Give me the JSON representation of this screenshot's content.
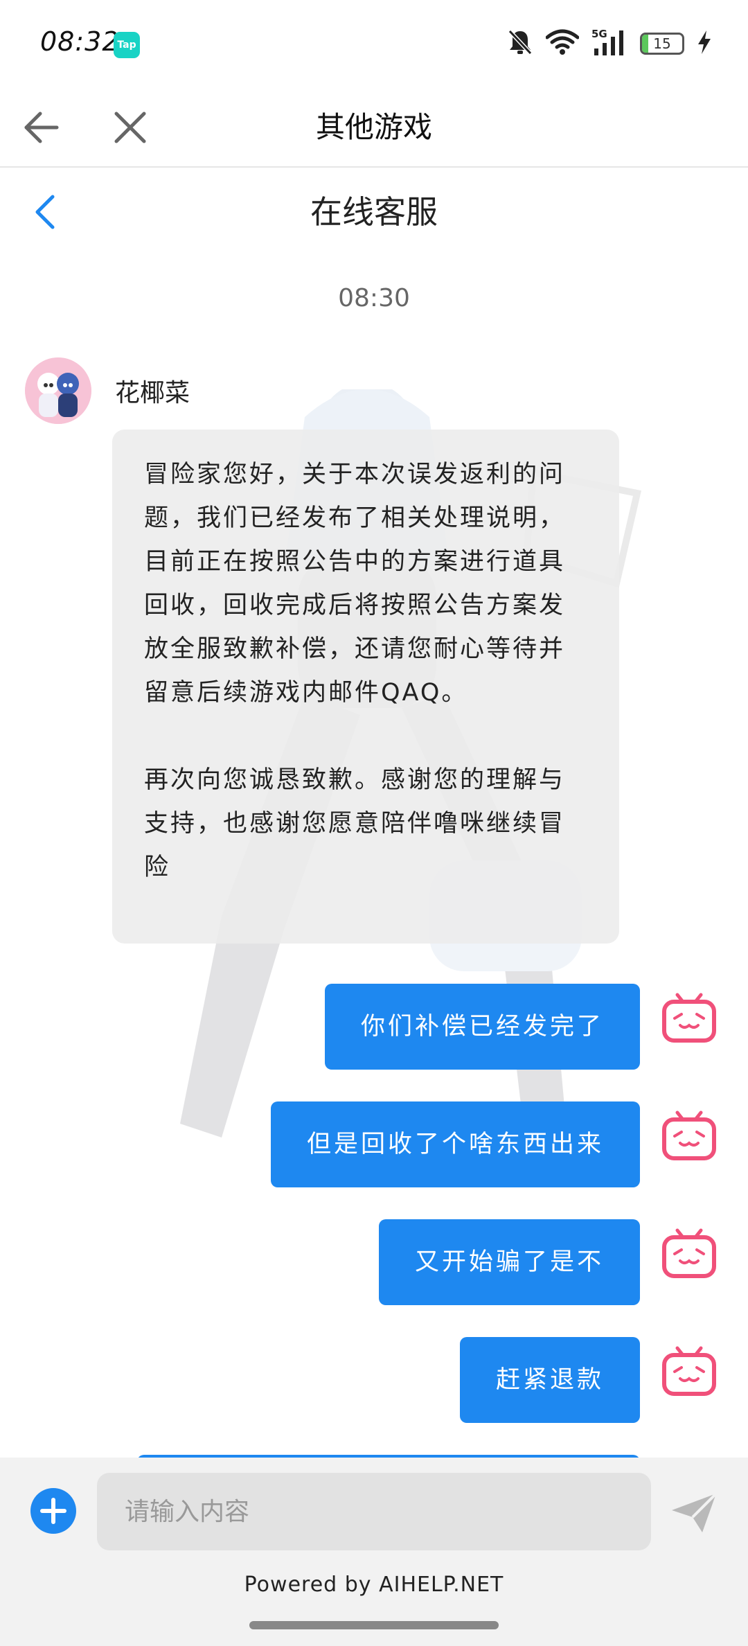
{
  "status_bar": {
    "time": "08:32",
    "app_badge": "Tap",
    "network": "5G",
    "battery_level": "15",
    "battery_fraction": 0.15,
    "icons": [
      "mute-bell-icon",
      "wifi-icon",
      "5g-signal-icon",
      "battery-icon",
      "charging-bolt-icon"
    ]
  },
  "nav": {
    "title": "其他游戏",
    "back_icon": "arrow-left-icon",
    "close_icon": "close-icon"
  },
  "chat_header": {
    "title": "在线客服",
    "back_icon": "chevron-left-icon"
  },
  "chat": {
    "timestamp": "08:30",
    "agent": {
      "name": "花椰菜",
      "message": "冒险家您好，关于本次误发返利的问题，我们已经发布了相关处理说明，目前正在按照公告中的方案进行道具回收，回收完成后将按照公告方案发放全服致歉补偿，还请您耐心等待并留意后续游戏内邮件QAQ。\n\n再次向您诚恳致歉。感谢您的理解与支持，也感谢您愿意陪伴噜咪继续冒险"
    },
    "user_messages": [
      {
        "text": "你们补偿已经发完了"
      },
      {
        "text": "但是回收了个啥东西出来"
      },
      {
        "text": "又开始骗了是不"
      },
      {
        "text": "赶紧退款"
      }
    ]
  },
  "input_bar": {
    "placeholder": "请输入内容",
    "value": "",
    "powered_by": "Powered by AIHELP.NET"
  },
  "colors": {
    "accent": "#1e88f0",
    "user_avatar": "#f0507a",
    "agent_bubble": "#ececec"
  }
}
